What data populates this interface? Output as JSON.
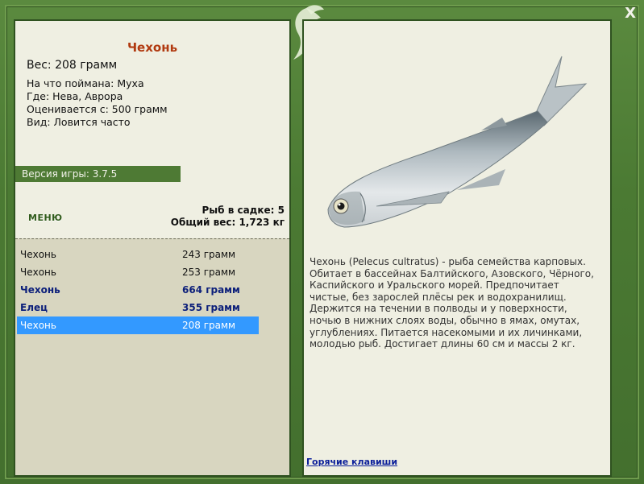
{
  "window": {
    "close_label": "X"
  },
  "fish": {
    "name": "Чехонь",
    "weight_line": "Вес: 208 грамм",
    "caught_on": "На что поймана: Муха",
    "where": "Где: Нева, Аврора",
    "valued_from": "Оценивается с: 500 грамм",
    "kind": "Вид: Ловится часто",
    "description": "Чехонь (Pelecus cultratus) - рыба семейства карповых. Обитает в бассейнах Балтийского, Азовского, Чёрного, Каспийского и Уральского морей. Предпочитает чистые, без зарослей плёсы рек и водохранилищ. Держится на течении в полводы и у поверхности, ночью в нижних слоях воды, обычно в ямах, омутах, углублениях. Питается насекомыми и их личинками, молодью рыб. Достигает длины 60 см и массы 2 кг."
  },
  "game_version": "Версия игры: 3.7.5",
  "menu_label": "МЕНЮ",
  "stats": {
    "fish_count": "Рыб в садке: 5",
    "total_weight": "Общий вес: 1,723 кг"
  },
  "catch_list": [
    {
      "name": "Чехонь",
      "weight": "243 грамм"
    },
    {
      "name": "Чехонь",
      "weight": "253 грамм"
    },
    {
      "name": "Чехонь",
      "weight": "664 грамм"
    },
    {
      "name": "Елец",
      "weight": "355 грамм"
    },
    {
      "name": "Чехонь",
      "weight": "208 грамм"
    }
  ],
  "hotkeys_label": "Горячие клавиши"
}
